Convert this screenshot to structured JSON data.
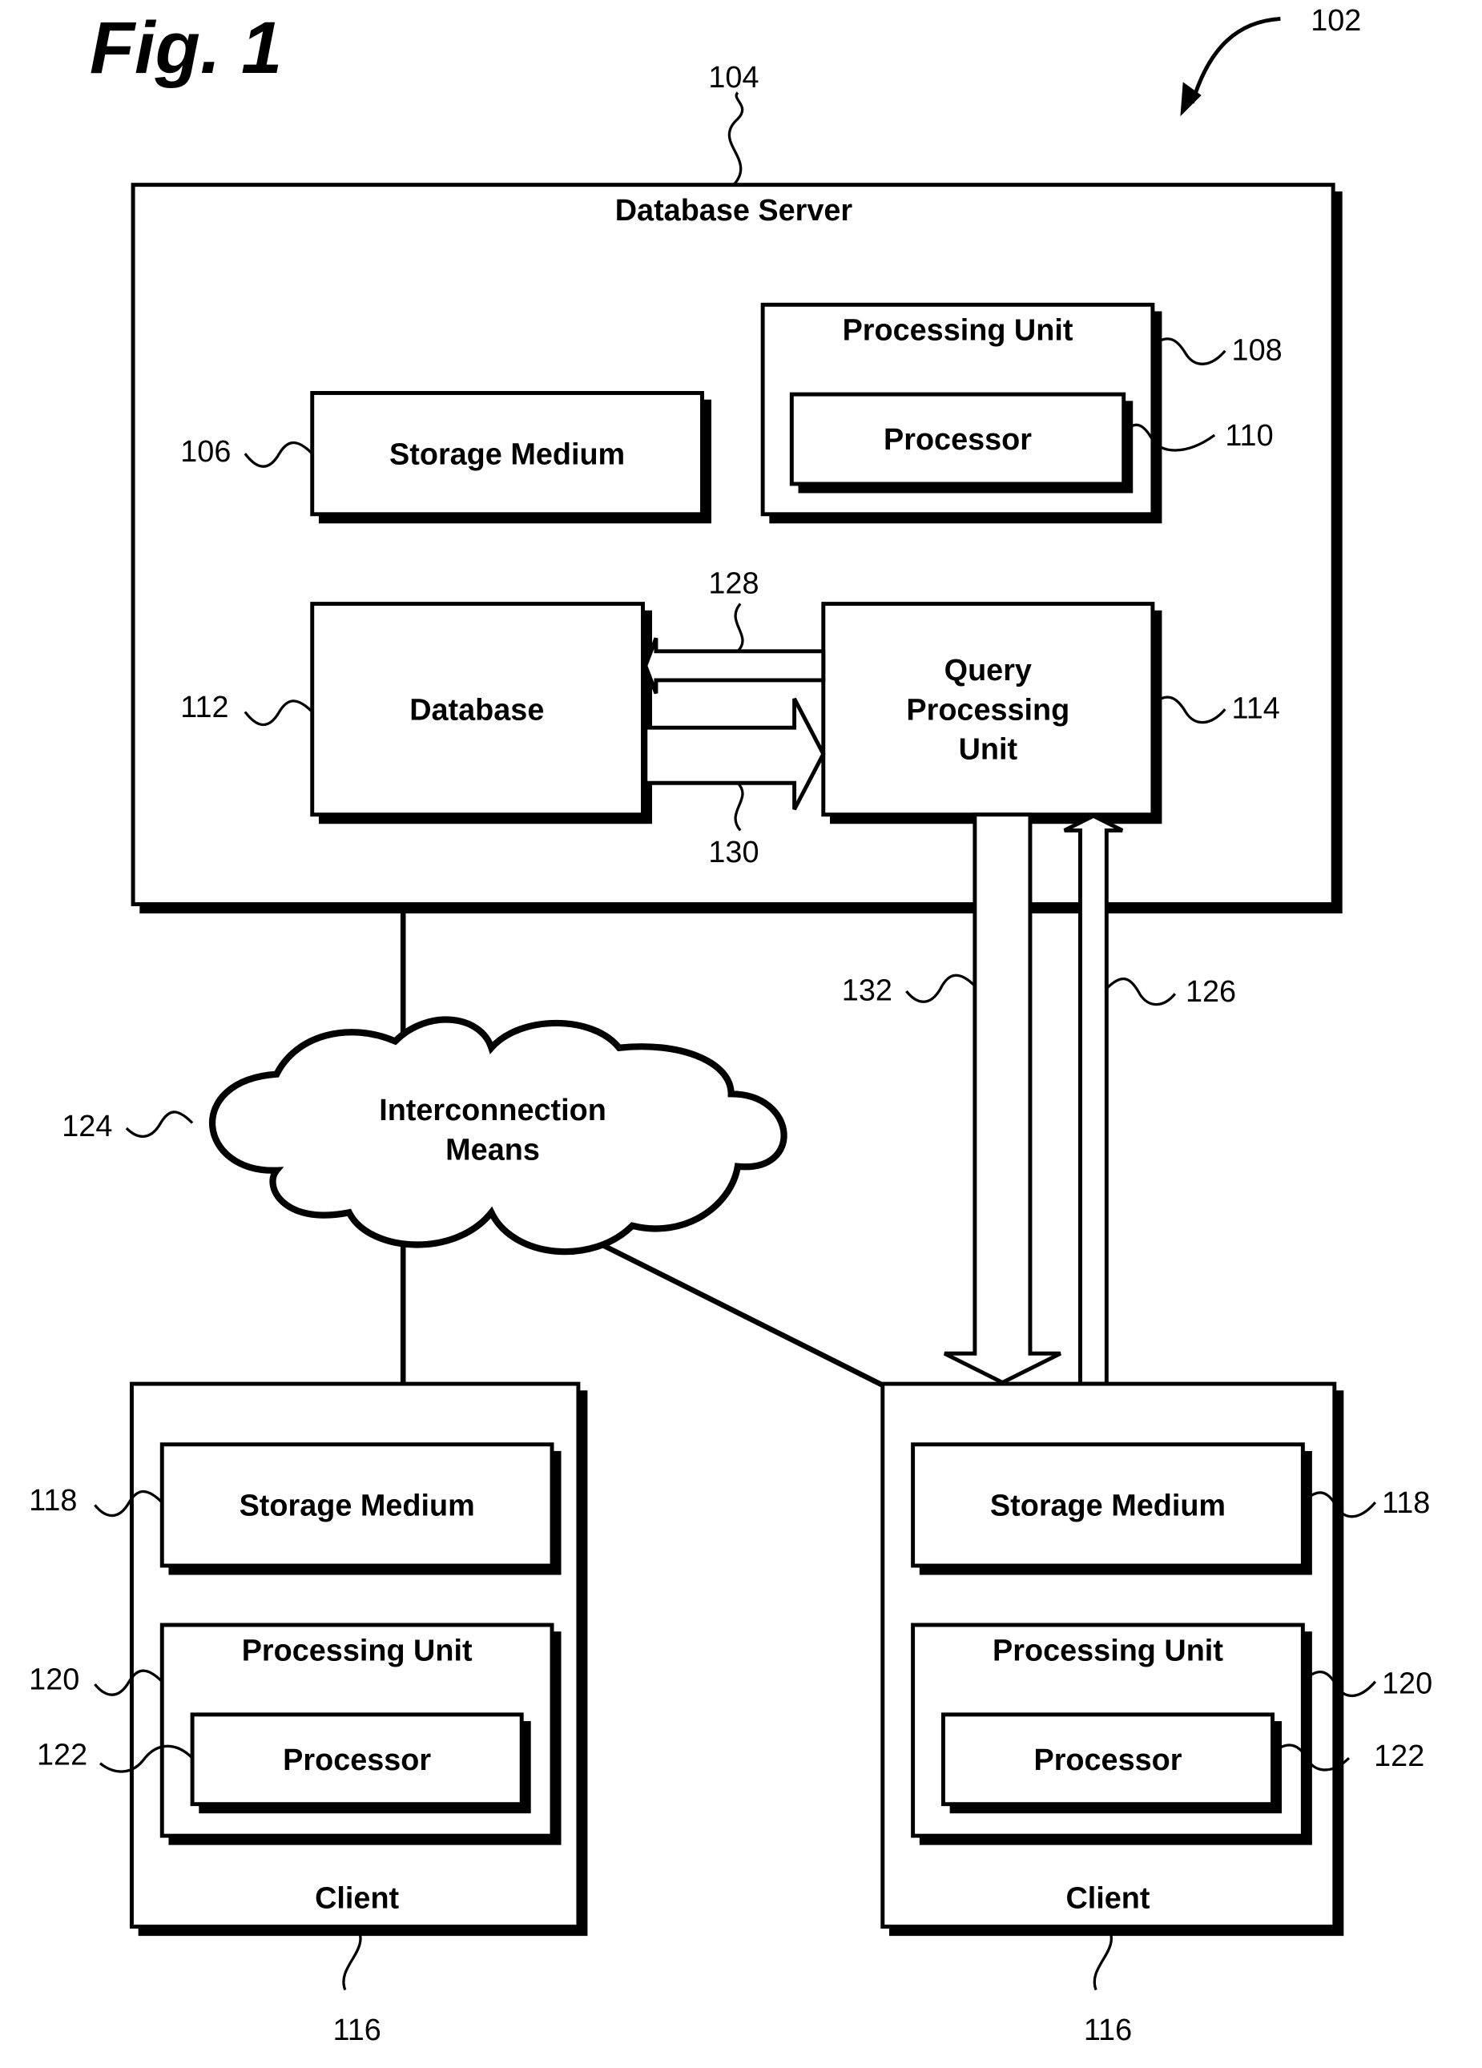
{
  "figure": {
    "title": "Fig. 1",
    "system_ref": "102"
  },
  "server": {
    "label": "Database Server",
    "ref": "104",
    "storage": {
      "label": "Storage Medium",
      "ref": "106"
    },
    "processing_unit": {
      "label": "Processing Unit",
      "ref": "108"
    },
    "processor": {
      "label": "Processor",
      "ref": "110"
    },
    "database": {
      "label": "Database",
      "ref": "112"
    },
    "query_unit": {
      "lines": [
        "Query",
        "Processing",
        "Unit"
      ],
      "ref": "114"
    },
    "arrow_to_db_ref": "128",
    "arrow_to_qpu_ref": "130"
  },
  "network": {
    "lines": [
      "Interconnection",
      "Means"
    ],
    "ref": "124"
  },
  "links": {
    "down_arrow_ref": "132",
    "up_arrow_ref": "126"
  },
  "clients": [
    {
      "label": "Client",
      "ref": "116",
      "storage": {
        "label": "Storage Medium",
        "ref": "118"
      },
      "processing_unit": {
        "label": "Processing Unit",
        "ref": "120"
      },
      "processor": {
        "label": "Processor",
        "ref": "122"
      }
    },
    {
      "label": "Client",
      "ref": "116",
      "storage": {
        "label": "Storage Medium",
        "ref": "118"
      },
      "processing_unit": {
        "label": "Processing Unit",
        "ref": "120"
      },
      "processor": {
        "label": "Processor",
        "ref": "122"
      }
    }
  ]
}
